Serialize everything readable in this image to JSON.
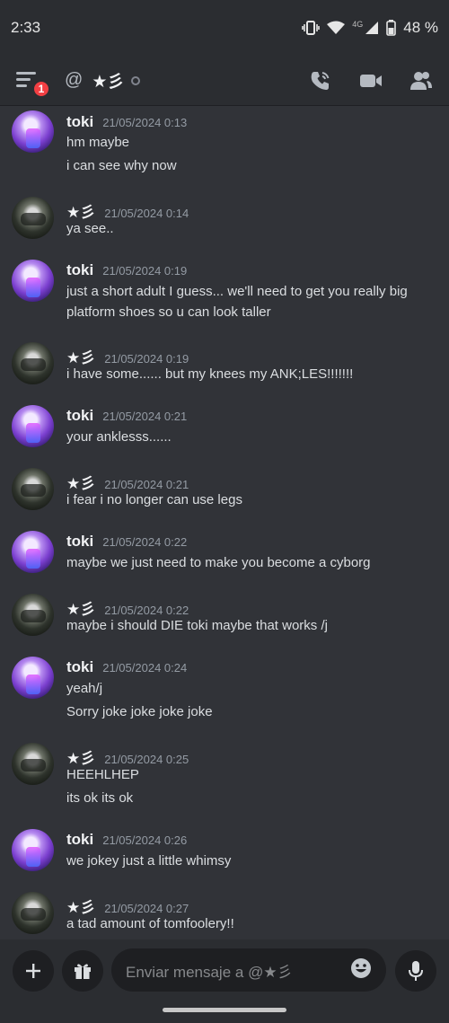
{
  "status_bar": {
    "time": "2:33",
    "network": "4G",
    "battery": "48 %"
  },
  "header": {
    "at_symbol": "@",
    "channel_name": "★彡",
    "notification_count": "1"
  },
  "messages": [
    {
      "author": "toki",
      "avatar": "toki",
      "timestamp": "21/05/2024 0:13",
      "lines": [
        "hm maybe",
        "i can see why now"
      ]
    },
    {
      "author": "★彡",
      "avatar": "star",
      "timestamp": "21/05/2024 0:14",
      "lines": [
        "ya see.."
      ]
    },
    {
      "author": "toki",
      "avatar": "toki",
      "timestamp": "21/05/2024 0:19",
      "lines": [
        "just a short adult I guess... we'll need to get you really big",
        "platform shoes so u can look taller"
      ]
    },
    {
      "author": "★彡",
      "avatar": "star",
      "timestamp": "21/05/2024 0:19",
      "lines": [
        "i have some...... but my knees my ANK;LES!!!!!!!"
      ]
    },
    {
      "author": "toki",
      "avatar": "toki",
      "timestamp": "21/05/2024 0:21",
      "lines": [
        "your anklesss......"
      ]
    },
    {
      "author": "★彡",
      "avatar": "star",
      "timestamp": "21/05/2024 0:21",
      "lines": [
        "i fear i no longer can use legs"
      ]
    },
    {
      "author": "toki",
      "avatar": "toki",
      "timestamp": "21/05/2024 0:22",
      "lines": [
        "maybe we just need to make you become a cyborg"
      ]
    },
    {
      "author": "★彡",
      "avatar": "star",
      "timestamp": "21/05/2024 0:22",
      "lines": [
        "maybe i should DIE toki maybe that works /j"
      ]
    },
    {
      "author": "toki",
      "avatar": "toki",
      "timestamp": "21/05/2024 0:24",
      "lines": [
        "yeah/j",
        "Sorry joke joke joke joke"
      ]
    },
    {
      "author": "★彡",
      "avatar": "star",
      "timestamp": "21/05/2024 0:25",
      "lines": [
        "HEEHLHEP",
        "its ok its ok"
      ]
    },
    {
      "author": "toki",
      "avatar": "toki",
      "timestamp": "21/05/2024 0:26",
      "lines": [
        "we jokey just a little whimsy"
      ]
    },
    {
      "author": "★彡",
      "avatar": "star",
      "timestamp": "21/05/2024 0:27",
      "lines": [
        "a tad amount of tomfoolery!!"
      ]
    }
  ],
  "composer": {
    "placeholder": "Enviar mensaje a @★彡"
  }
}
